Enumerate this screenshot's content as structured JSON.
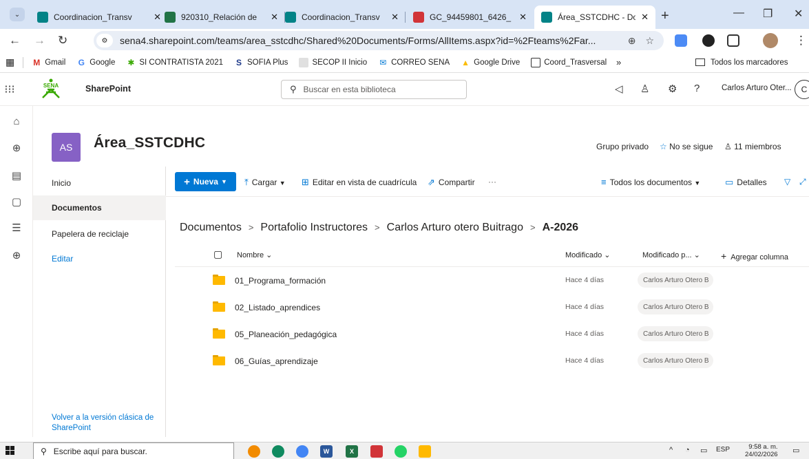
{
  "browser": {
    "tabs": [
      {
        "title": "Coordinacion_Transv",
        "color": "#038387"
      },
      {
        "title": "920310_Relación de",
        "color": "#217346"
      },
      {
        "title": "Coordinacion_Transv",
        "color": "#038387"
      },
      {
        "title": "GC_94459801_6426_",
        "color": "#d13438"
      },
      {
        "title": "Área_SSTCDHC - Doc",
        "color": "#038387"
      }
    ],
    "url": "sena4.sharepoint.com/teams/area_sstcdhc/Shared%20Documents/Forms/AllItems.aspx?id=%2Fteams%2Far...",
    "bookmarks": [
      {
        "label": "Gmail",
        "icon": "gmail-icon",
        "color": "#d93025",
        "glyph": "M"
      },
      {
        "label": "Google",
        "icon": "google-icon",
        "color": "#4285f4",
        "glyph": "G"
      },
      {
        "label": "SI CONTRATISTA 2021",
        "icon": "sena-icon",
        "color": "#39a900",
        "glyph": "✱"
      },
      {
        "label": "SOFIA Plus",
        "icon": "sofia-icon",
        "color": "#1e3a8a",
        "glyph": "S"
      },
      {
        "label": "SECOP II Inicio",
        "icon": "secop-icon",
        "color": "#e0e0e0",
        "glyph": ""
      },
      {
        "label": "CORREO SENA",
        "icon": "outlook-icon",
        "color": "#0078d4",
        "glyph": "✉"
      },
      {
        "label": "Google Drive",
        "icon": "drive-icon",
        "color": "#fbbc04",
        "glyph": "▲"
      },
      {
        "label": "Coord_Trasversal",
        "icon": "folder-icon",
        "color": "#ffffff",
        "glyph": "▭"
      }
    ],
    "bookmarks_more": "»",
    "all_bookmarks": "Todos los marcadores"
  },
  "sharepoint": {
    "app_name": "SharePoint",
    "search_placeholder": "Buscar en esta biblioteca",
    "user_name": "Carlos Arturo Oter...",
    "user_initial": "C"
  },
  "site": {
    "avatar_initials": "AS",
    "avatar_color": "#8661c5",
    "title": "Área_SSTCDHC",
    "privacy": "Grupo privado",
    "follow": "No se sigue",
    "members": "11 miembros"
  },
  "leftnav": {
    "items": [
      "Inicio",
      "Documentos",
      "Papelera de reciclaje",
      "Editar"
    ],
    "classic_link": "Volver a la versión clásica de SharePoint"
  },
  "commandbar": {
    "new": "Nueva",
    "upload": "Cargar",
    "grid_edit": "Editar en vista de cuadrícula",
    "share": "Compartir",
    "more": "···",
    "view": "Todos los documentos",
    "details": "Detalles"
  },
  "breadcrumb": [
    "Documentos",
    "Portafolio Instructores",
    "Carlos Arturo otero Buitrago",
    "A-2026"
  ],
  "list": {
    "columns": {
      "name": "Nombre",
      "modified": "Modificado",
      "modified_by": "Modificado p...",
      "add_column": "Agregar columna"
    },
    "rows": [
      {
        "name": "01_Programa_formación",
        "modified": "Hace 4 días",
        "modified_by": "Carlos Arturo Otero B"
      },
      {
        "name": "02_Listado_aprendices",
        "modified": "Hace 4 días",
        "modified_by": "Carlos Arturo Otero B"
      },
      {
        "name": "05_Planeación_pedagógica",
        "modified": "Hace 4 días",
        "modified_by": "Carlos Arturo Otero B"
      },
      {
        "name": "06_Guías_aprendizaje",
        "modified": "Hace 4 días",
        "modified_by": "Carlos Arturo Otero B"
      }
    ]
  },
  "taskbar": {
    "search_placeholder": "Escribe aquí para buscar.",
    "language": "ESP",
    "time": "9:58 a. m.",
    "date": "24/02/2026"
  }
}
